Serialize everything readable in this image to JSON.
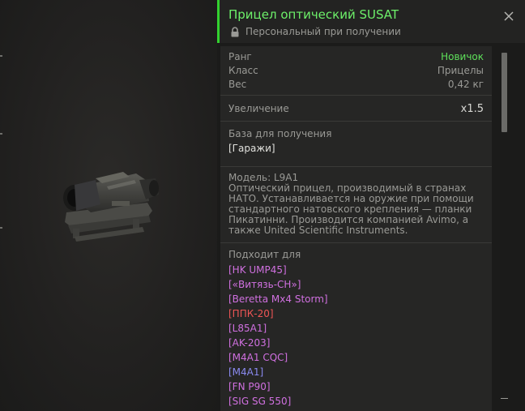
{
  "item": {
    "title": "Прицел оптический SUSAT",
    "binding": "Персональный при получении"
  },
  "stats": [
    {
      "label": "Ранг",
      "value": "Новичок"
    },
    {
      "label": "Класс",
      "value": "Прицелы"
    },
    {
      "label": "Вес",
      "value": "0,42 кг"
    }
  ],
  "zoom": {
    "label": "Увеличение",
    "value": "x1.5"
  },
  "base": {
    "label": "База для получения",
    "value": "[Гаражи]"
  },
  "description": {
    "model": "Модель: L9A1",
    "text": "Оптический прицел, производимый в странах НАТО. Устанавливается на оружие при помощи стандартного натовского крепления — планки Пикатинни. Производится компанией Avimo, а также United Scientific Instruments."
  },
  "fits": {
    "label": "Подходит для",
    "weapons": [
      {
        "name": "[HK UMP45]",
        "color": "#d070e0"
      },
      {
        "name": "[«Витязь-СН»]",
        "color": "#d070e0"
      },
      {
        "name": "[Beretta Mx4 Storm]",
        "color": "#d070e0"
      },
      {
        "name": "[ППК-20]",
        "color": "#ee5555"
      },
      {
        "name": "[L85A1]",
        "color": "#d070e0"
      },
      {
        "name": "[AK-203]",
        "color": "#d070e0"
      },
      {
        "name": "[M4A1 CQC]",
        "color": "#d070e0"
      },
      {
        "name": "[M4A1]",
        "color": "#8a8af0"
      },
      {
        "name": "[FN P90]",
        "color": "#d070e0"
      },
      {
        "name": "[SIG SG 550]",
        "color": "#d070e0"
      }
    ]
  },
  "colors": {
    "accent": "#33d12f",
    "title": "#6df06a",
    "rank": "#5ee05a"
  },
  "icons": {
    "lock": "lock-icon",
    "close": "close-icon"
  }
}
